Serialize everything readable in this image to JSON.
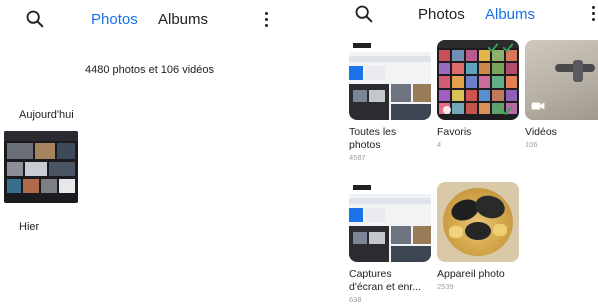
{
  "left_panel": {
    "tabs": {
      "photos": "Photos",
      "albums": "Albums"
    },
    "summary": "4480 photos et 106 vidéos",
    "sections": [
      {
        "label": "Aujourd'hui"
      },
      {
        "label": "Hier"
      }
    ]
  },
  "right_panel": {
    "tabs": {
      "photos": "Photos",
      "albums": "Albums"
    },
    "albums": [
      {
        "title_lines": [
          "Toutes les",
          "photos"
        ],
        "count": "4587"
      },
      {
        "title_lines": [
          "Favoris"
        ],
        "count": "4"
      },
      {
        "title_lines": [
          "Vidéos"
        ],
        "count": "106"
      },
      {
        "title_lines": [
          "Captures",
          "d'écran et enr..."
        ],
        "count": "638"
      },
      {
        "title_lines": [
          "Appareil photo"
        ],
        "count": "2539"
      }
    ]
  },
  "colors": {
    "accent": "#1a73e8",
    "text": "#202124",
    "secondary_text": "#9aa0a6",
    "background": "#ffffff"
  },
  "icons": {
    "search": "search-icon",
    "more": "more-vert-icon",
    "favorite_check": "check-icon",
    "video": "video-camera-icon"
  }
}
